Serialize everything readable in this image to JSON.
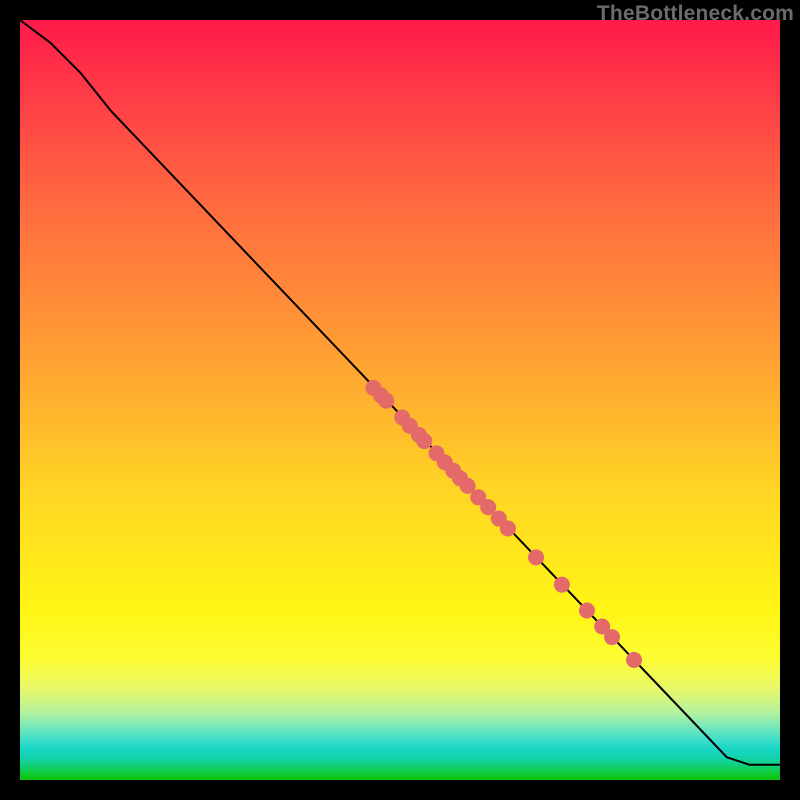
{
  "watermark": "TheBottleneck.com",
  "chart_data": {
    "type": "line",
    "title": "",
    "xlabel": "",
    "ylabel": "",
    "xlim": [
      0,
      100
    ],
    "ylim": [
      0,
      100
    ],
    "grid": false,
    "legend": false,
    "line": {
      "color": "#000000",
      "points": [
        {
          "x": 0,
          "y": 100
        },
        {
          "x": 4,
          "y": 97
        },
        {
          "x": 8,
          "y": 93
        },
        {
          "x": 12,
          "y": 88
        },
        {
          "x": 93,
          "y": 3
        },
        {
          "x": 96,
          "y": 2
        },
        {
          "x": 100,
          "y": 2
        }
      ]
    },
    "markers": {
      "color": "#e46a6a",
      "radius_px": 8,
      "points": [
        {
          "x": 46.5,
          "y": 51.6
        },
        {
          "x": 47.5,
          "y": 50.6
        },
        {
          "x": 48.2,
          "y": 49.9
        },
        {
          "x": 50.3,
          "y": 47.7
        },
        {
          "x": 51.3,
          "y": 46.6
        },
        {
          "x": 52.5,
          "y": 45.4
        },
        {
          "x": 53.2,
          "y": 44.6
        },
        {
          "x": 54.8,
          "y": 43.0
        },
        {
          "x": 55.9,
          "y": 41.8
        },
        {
          "x": 57.0,
          "y": 40.7
        },
        {
          "x": 57.9,
          "y": 39.7
        },
        {
          "x": 58.9,
          "y": 38.7
        },
        {
          "x": 60.3,
          "y": 37.2
        },
        {
          "x": 61.6,
          "y": 35.9
        },
        {
          "x": 63.0,
          "y": 34.4
        },
        {
          "x": 64.2,
          "y": 33.1
        },
        {
          "x": 67.9,
          "y": 29.3
        },
        {
          "x": 71.3,
          "y": 25.7
        },
        {
          "x": 74.6,
          "y": 22.3
        },
        {
          "x": 76.6,
          "y": 20.2
        },
        {
          "x": 77.9,
          "y": 18.8
        },
        {
          "x": 80.8,
          "y": 15.8
        }
      ]
    },
    "background_gradient_stops": [
      {
        "pos": 0.0,
        "color": "#ff1a4b"
      },
      {
        "pos": 0.08,
        "color": "#ff3648"
      },
      {
        "pos": 0.25,
        "color": "#ff6c3f"
      },
      {
        "pos": 0.45,
        "color": "#ffa233"
      },
      {
        "pos": 0.62,
        "color": "#ffd524"
      },
      {
        "pos": 0.78,
        "color": "#fff615"
      },
      {
        "pos": 0.84,
        "color": "#fdfd33"
      },
      {
        "pos": 0.88,
        "color": "#e8f86a"
      },
      {
        "pos": 0.91,
        "color": "#b6f29b"
      },
      {
        "pos": 0.93,
        "color": "#77e8bb"
      },
      {
        "pos": 0.95,
        "color": "#33dccb"
      },
      {
        "pos": 0.96,
        "color": "#17d6c3"
      },
      {
        "pos": 0.97,
        "color": "#14d3ae"
      },
      {
        "pos": 0.98,
        "color": "#12d07f"
      },
      {
        "pos": 0.99,
        "color": "#0fcb3f"
      },
      {
        "pos": 1.0,
        "color": "#0cc407"
      }
    ]
  }
}
